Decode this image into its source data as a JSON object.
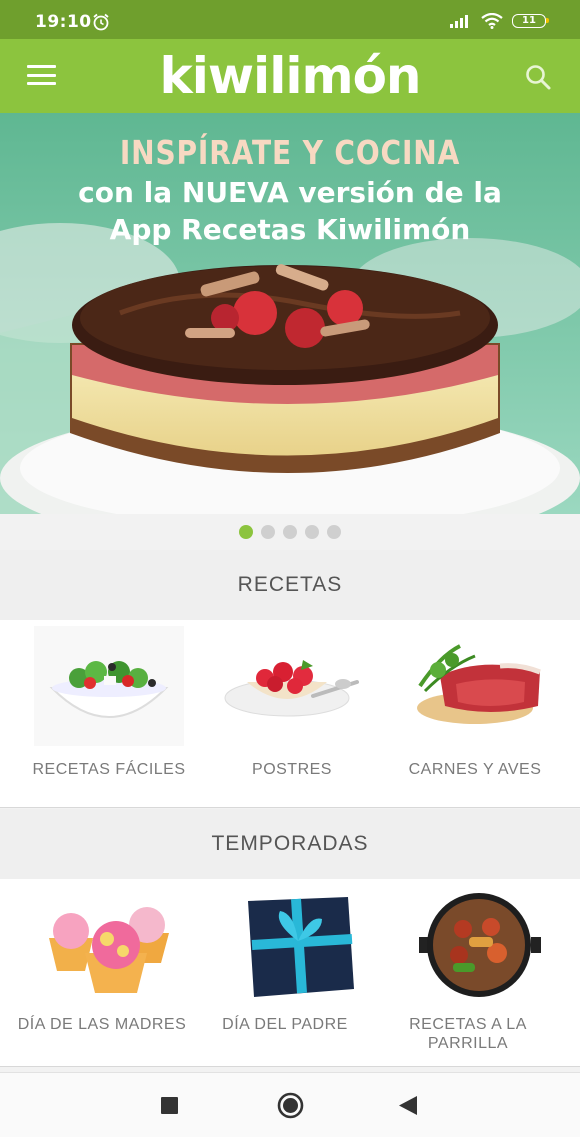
{
  "status": {
    "time": "19:10",
    "battery": "11"
  },
  "app": {
    "logo": "kiwilimón"
  },
  "hero": {
    "headline": "INSPÍRATE Y COCINA",
    "line2": "con la NUEVA versión de la",
    "line3": "App Recetas Kiwilimón",
    "slides": 5,
    "active_slide": 1
  },
  "sections": [
    {
      "title": "RECETAS",
      "items": [
        {
          "label": "RECETAS FÁCILES",
          "icon": "salad-bowl-image"
        },
        {
          "label": "POSTRES",
          "icon": "strawberry-dessert-image"
        },
        {
          "label": "CARNES Y AVES",
          "icon": "raw-meat-image"
        }
      ]
    },
    {
      "title": "TEMPORADAS",
      "items": [
        {
          "label": "DÍA DE LAS MADRES",
          "icon": "cupcakes-image"
        },
        {
          "label": "DÍA DEL PADRE",
          "icon": "gift-box-image"
        },
        {
          "label": "RECETAS A LA PARRILLA",
          "icon": "grill-image"
        }
      ]
    }
  ],
  "colors": {
    "statusbar": "#6f9f2d",
    "appbar": "#8cc43e",
    "accent": "#8cc43e"
  }
}
